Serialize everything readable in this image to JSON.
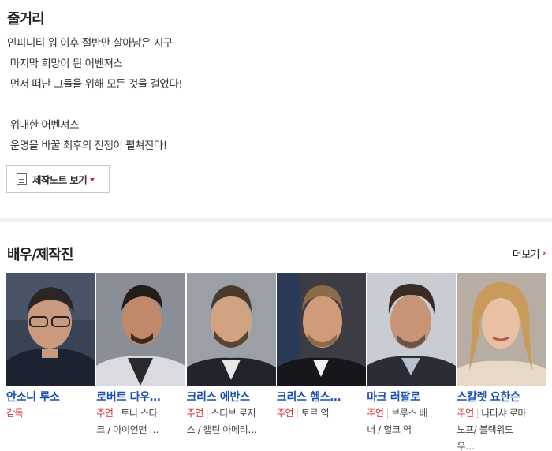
{
  "synopsis": {
    "title": "줄거리",
    "lines": [
      "인피니티 워 이후 절반만 살아남은 지구",
      " 마지막 희망이 된 어벤져스",
      " 먼저 떠난 그들을 위해 모든 것을 걸었다!",
      "",
      " 위대한 어벤져스",
      " 운명을 바꿀 최후의 전쟁이 펼쳐진다!"
    ],
    "note_button": "제작노트 보기"
  },
  "cast": {
    "title": "배우/제작진",
    "more_label": "더보기",
    "items": [
      {
        "name": "안소니 루소",
        "role_type": "감독",
        "role_line1": "",
        "role_line2": "",
        "role_line3": ""
      },
      {
        "name": "로버트 다우…",
        "role_type": "주연",
        "role_line1": "토니 스타",
        "role_line2": "크 / 아이언맨 …",
        "role_line3": ""
      },
      {
        "name": "크리스 에반스",
        "role_type": "주연",
        "role_line1": "스티브 로저",
        "role_line2": "스 / 캡틴 아메리…",
        "role_line3": ""
      },
      {
        "name": "크리스 헴스…",
        "role_type": "주연",
        "role_line1": "토르 역",
        "role_line2": "",
        "role_line3": ""
      },
      {
        "name": "마크 러팔로",
        "role_type": "주연",
        "role_line1": "브루스 배",
        "role_line2": "너 / 헐크 역",
        "role_line3": ""
      },
      {
        "name": "스칼렛 요한슨",
        "role_type": "주연",
        "role_line1": "나타샤 로마",
        "role_line2": "노프/ 블랙위도",
        "role_line3": "우…"
      }
    ]
  },
  "colors": {
    "link_blue": "#1a4fb0",
    "accent_red": "#d6262c",
    "divider": "#f0f0f0"
  }
}
